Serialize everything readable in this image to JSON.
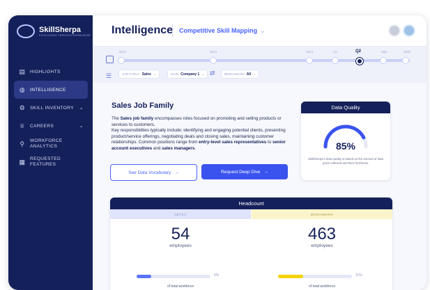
{
  "brand": {
    "name": "SkillSherpa",
    "tagline": "EXCELLENCE THROUGH KNOWLEDGE"
  },
  "sidebar": {
    "items": [
      {
        "label": "HIGHLIGHTS",
        "icon": "highlights-icon"
      },
      {
        "label": "INTELLIGENCE",
        "icon": "globe-icon",
        "active": true
      },
      {
        "label": "SKILL INVENTORY",
        "icon": "gear-icon"
      },
      {
        "label": "CAREERS",
        "icon": "trophy-icon"
      },
      {
        "label_1": "WORKFORCE",
        "label_2": "ANALYTICS",
        "icon": "people-icon"
      },
      {
        "label_1": "REQUESTED",
        "label_2": "FEATURES",
        "icon": "grid-icon"
      }
    ]
  },
  "header": {
    "title": "Intelligence",
    "subtitle": "Competitive Skill Mapping"
  },
  "timeline": {
    "labels": [
      "2022",
      "2023",
      "2024",
      "1H",
      "Q2",
      "3Q3",
      "2025"
    ],
    "current": "Q2"
  },
  "filters": {
    "job_family": {
      "label": "JOB FAMILY",
      "value": "Sales"
    },
    "main": {
      "label": "MAIN",
      "value": "Company 1"
    },
    "benchmark": {
      "label": "BENCHMARK",
      "value": "All"
    }
  },
  "job": {
    "title": "Sales Job Family",
    "desc_1": "The ",
    "desc_bold_1": "Sales job family",
    "desc_2": " encompasses roles focused on promoting and selling products or services to customers.",
    "desc_3": "Key responsibilities typically include: identifying and engaging potential clients, presenting product/service offerings, negotiating deals and closing sales, maintaining customer relationships. Common positions range from ",
    "desc_bold_2": "entry-level sales representatives",
    "desc_4": " to ",
    "desc_bold_3": "senior account executives",
    "desc_5": " and ",
    "desc_bold_4": "sales managers",
    "desc_6": "."
  },
  "buttons": {
    "vocab": "See Data Vocabulary",
    "deep_dive": "Request Deep Dive",
    "arrow": "→"
  },
  "data_quality": {
    "title": "Data Quality",
    "value": "85%",
    "fraction": 0.85,
    "note": "SkillSherpa's data quality is based on the amount of data point collected and their freshness."
  },
  "headcount": {
    "title": "Headcount",
    "left": {
      "label": "NETEX",
      "value": "54",
      "unit": "employees",
      "pct": "5%",
      "pct_note": "of total workforce",
      "fraction": 0.05,
      "color": "#5a73ff"
    },
    "right": {
      "label": "BENCHMARK",
      "value": "463",
      "unit": "employees",
      "pct": "11%",
      "pct_note": "of total workforce",
      "fraction": 0.11,
      "color": "#f5d100"
    }
  }
}
